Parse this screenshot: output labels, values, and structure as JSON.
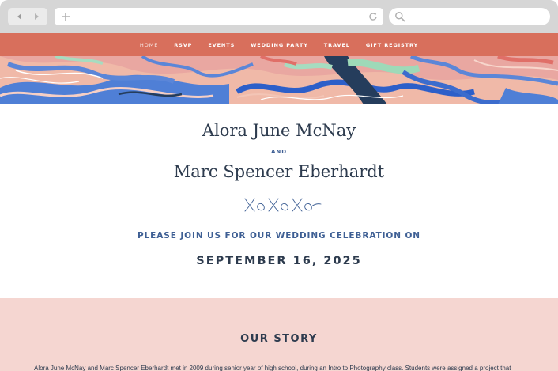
{
  "colors": {
    "accent": "#d86f5c",
    "navy": "#2d3b4e",
    "blue": "#3e5f94",
    "story_bg": "#f5d6d1"
  },
  "browser": {
    "icons": [
      "back-arrow-icon",
      "forward-arrow-icon",
      "plus-icon",
      "reload-icon",
      "search-icon"
    ]
  },
  "nav": {
    "items": [
      {
        "label": "HOME"
      },
      {
        "label": "RSVP"
      },
      {
        "label": "EVENTS"
      },
      {
        "label": "WEDDING PARTY"
      },
      {
        "label": "TRAVEL"
      },
      {
        "label": "GIFT REGISTRY"
      }
    ]
  },
  "hero": {
    "name1": "Alora June McNay",
    "and": "AND",
    "name2": "Marc Spencer Eberhardt",
    "signature": "xoxoxo",
    "invite": "PLEASE JOIN US FOR OUR WEDDING CELEBRATION ON",
    "date": "SEPTEMBER 16, 2025"
  },
  "story": {
    "title": "OUR STORY",
    "text": "Alora June McNay and Marc Spencer Eberhardt met in 2009 during senior year of high school, during an Intro to Photography class. Students were assigned a project that"
  }
}
